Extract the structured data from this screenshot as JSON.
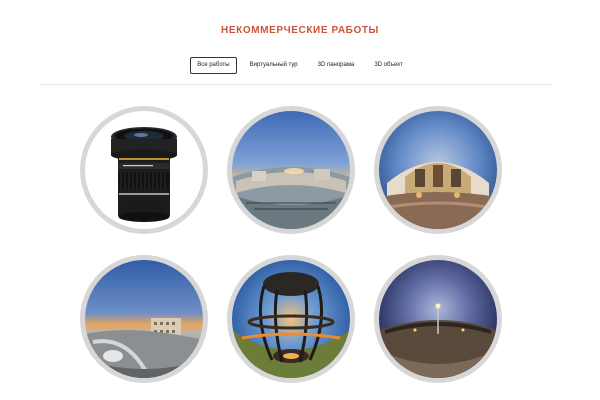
{
  "page": {
    "title": "НЕКОММЕРЧЕСКИЕ РАБОТЫ"
  },
  "filters": [
    {
      "label": "Все работы",
      "active": true
    },
    {
      "label": "Виртуальный тур",
      "active": false
    },
    {
      "label": "3D панорама",
      "active": false
    },
    {
      "label": "3D объект",
      "active": false
    }
  ],
  "gallery": {
    "items": [
      {
        "subject": "camera-lens"
      },
      {
        "subject": "rooftop-sunset-panorama"
      },
      {
        "subject": "building-facade-panorama"
      },
      {
        "subject": "rooftop-evening-panorama"
      },
      {
        "subject": "gazebo-tiny-planet"
      },
      {
        "subject": "night-square-tiny-planet"
      }
    ]
  },
  "colors": {
    "title": "#c9553a",
    "ring": "#d7d7d7",
    "active_border": "#333333"
  }
}
